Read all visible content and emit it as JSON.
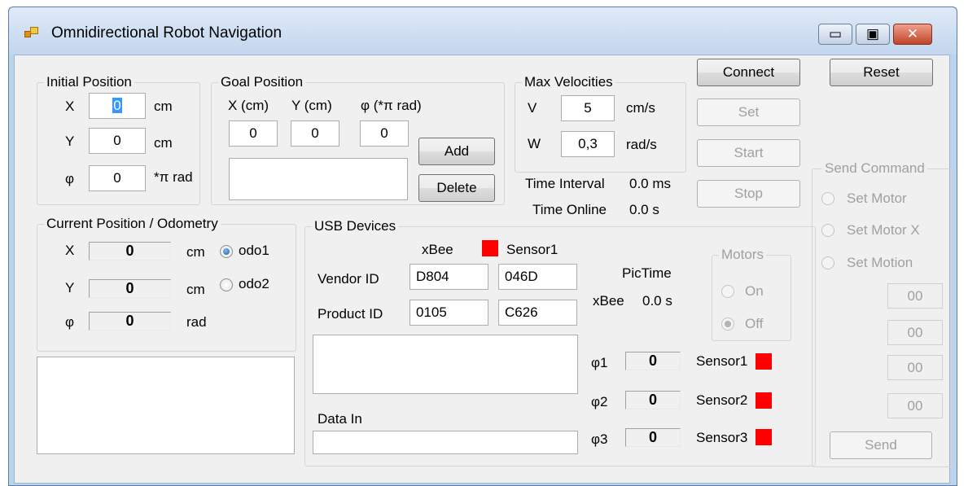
{
  "window": {
    "title": "Omnidirectional Robot Navigation"
  },
  "caption_buttons": {
    "minimize": "▭",
    "maximize": "▣",
    "close": "✕"
  },
  "initial_position": {
    "title": "Initial Position",
    "x_label": "X",
    "x_value": "0",
    "x_unit": "cm",
    "y_label": "Y",
    "y_value": "0",
    "y_unit": "cm",
    "phi_label": "φ",
    "phi_value": "0",
    "phi_unit": "*π rad"
  },
  "goal_position": {
    "title": "Goal Position",
    "x_header": "X (cm)",
    "y_header": "Y (cm)",
    "phi_header": "φ (*π rad)",
    "x_value": "0",
    "y_value": "0",
    "phi_value": "0",
    "add_label": "Add",
    "delete_label": "Delete"
  },
  "max_velocities": {
    "title": "Max Velocities",
    "v_label": "V",
    "v_value": "5",
    "v_unit": "cm/s",
    "w_label": "W",
    "w_value": "0,3",
    "w_unit": "rad/s"
  },
  "timing": {
    "interval_label": "Time Interval",
    "interval_value": "0.0 ms",
    "online_label": "Time Online",
    "online_value": "0.0 s"
  },
  "controls": {
    "connect_label": "Connect",
    "reset_label": "Reset",
    "set_label": "Set",
    "start_label": "Start",
    "stop_label": "Stop"
  },
  "current_position": {
    "title": "Current Position / Odometry",
    "x_label": "X",
    "x_value": "0",
    "x_unit": "cm",
    "y_label": "Y",
    "y_value": "0",
    "y_unit": "cm",
    "phi_label": "φ",
    "phi_value": "0",
    "phi_unit": "rad",
    "odo1_label": "odo1",
    "odo2_label": "odo2"
  },
  "usb_devices": {
    "title": "USB Devices",
    "xbee_header": "xBee",
    "sensor1_header": "Sensor1",
    "vendor_label": "Vendor ID",
    "xbee_vendor": "D804",
    "sensor_vendor": "046D",
    "product_label": "Product ID",
    "xbee_product": "0105",
    "sensor_product": "C626",
    "pictime_label": "PicTime",
    "xbee_time_label": "xBee",
    "xbee_time_value": "0.0 s",
    "data_in_label": "Data In",
    "phi1_label": "φ1",
    "phi1_value": "0",
    "sensor1_label": "Sensor1",
    "phi2_label": "φ2",
    "phi2_value": "0",
    "sensor2_label": "Sensor2",
    "phi3_label": "φ3",
    "phi3_value": "0",
    "sensor3_label": "Sensor3",
    "status_color": "#ff0000"
  },
  "motors": {
    "title": "Motors",
    "on_label": "On",
    "off_label": "Off"
  },
  "send_command": {
    "title": "Send Command",
    "set_motor_label": "Set Motor",
    "set_motor_x_label": "Set Motor X",
    "set_motion_label": "Set Motion",
    "field1": "00",
    "field2": "00",
    "field3": "00",
    "field4": "00",
    "send_label": "Send"
  }
}
